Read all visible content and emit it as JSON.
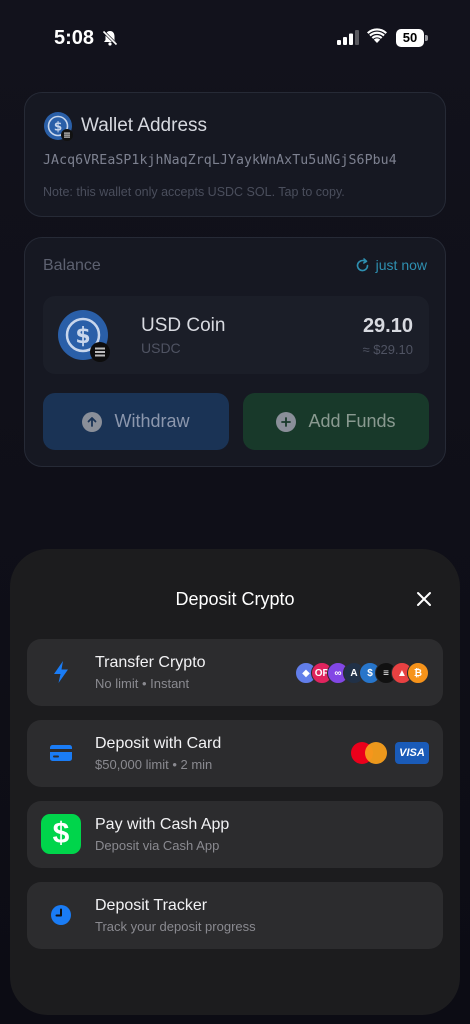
{
  "status": {
    "time": "5:08",
    "battery": "50"
  },
  "wallet": {
    "title": "Wallet Address",
    "address": "JAcq6VREaSP1kjhNaqZrqLJYaykWnAxTu5uNGjS6Pbu4",
    "note": "Note: this wallet only accepts USDC SOL. Tap to copy."
  },
  "balance": {
    "label": "Balance",
    "refresh_text": "just now",
    "coin": {
      "name": "USD Coin",
      "symbol": "USDC",
      "amount": "29.10",
      "usd_value": "≈ $29.10"
    },
    "withdraw_label": "Withdraw",
    "add_funds_label": "Add Funds"
  },
  "sheet": {
    "title": "Deposit Crypto",
    "options": [
      {
        "title": "Transfer Crypto",
        "subtitle": "No limit • Instant",
        "icon": "lightning-icon"
      },
      {
        "title": "Deposit with Card",
        "subtitle": "$50,000 limit • 2 min",
        "icon": "credit-card-icon"
      },
      {
        "title": "Pay with Cash App",
        "subtitle": "Deposit via Cash App",
        "icon": "cash-app-icon"
      },
      {
        "title": "Deposit Tracker",
        "subtitle": "Track your deposit progress",
        "icon": "clock-icon"
      }
    ],
    "card_brand": "VISA"
  },
  "colors": {
    "accent_blue": "#1a7cf5",
    "cash_app_green": "#00d54b",
    "refresh_teal": "#2e8fb0"
  }
}
